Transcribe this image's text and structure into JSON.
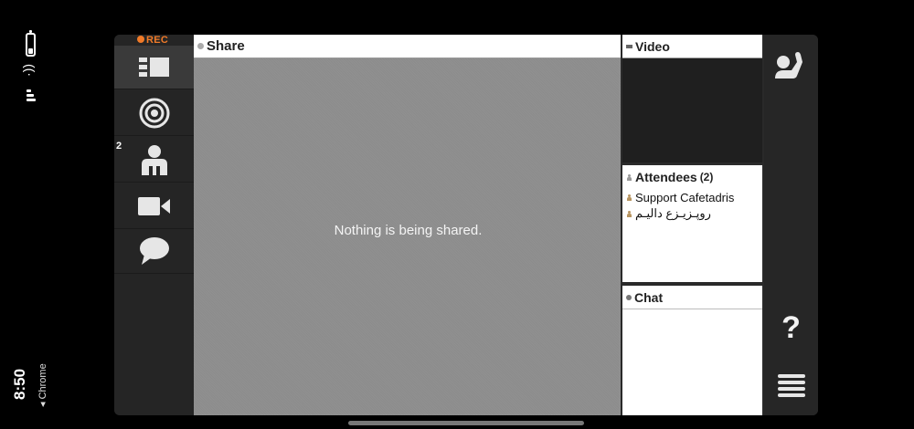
{
  "status": {
    "time": "8:50",
    "browser": "◂ Chrome"
  },
  "recording": {
    "label": "REC",
    "color": "#f07a28"
  },
  "tools": [
    {
      "name": "layout",
      "icon": "layout-icon",
      "active": true
    },
    {
      "name": "broadcast",
      "icon": "broadcast-icon"
    },
    {
      "name": "attendees",
      "icon": "person-icon",
      "badge": "2"
    },
    {
      "name": "camera",
      "icon": "video-camera-icon"
    },
    {
      "name": "chat",
      "icon": "chat-bubble-icon"
    }
  ],
  "share": {
    "title": "Share",
    "message": "Nothing is being shared."
  },
  "video": {
    "title": "Video"
  },
  "attendees": {
    "title": "Attendees",
    "count": "(2)",
    "list": [
      "Support Cafetadris",
      "روپـزيـزع داليـم"
    ]
  },
  "chat": {
    "title": "Chat"
  },
  "actions": [
    {
      "name": "raise-hand",
      "icon": "raise-hand-icon"
    },
    {
      "name": "help",
      "icon": "help-icon",
      "glyph": "?"
    },
    {
      "name": "menu",
      "icon": "hamburger-menu-icon"
    }
  ]
}
